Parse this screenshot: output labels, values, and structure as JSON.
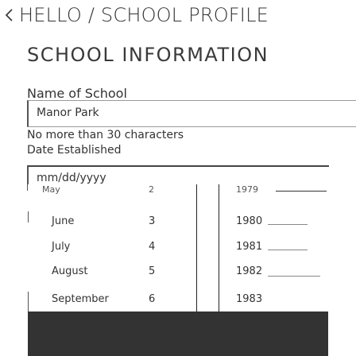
{
  "header": {
    "title": "HELLO / SCHOOL PROFILE",
    "back_icon": "chevron-left-icon"
  },
  "section": {
    "title": "SCHOOL INFORMATION"
  },
  "school_name": {
    "label": "Name of School",
    "value": "Manor Park",
    "hint": "No more than 30 characters"
  },
  "date_established": {
    "label": "Date Established",
    "placeholder": "mm/dd/yyyy"
  },
  "picker": {
    "months": [
      "May",
      "June",
      "July",
      "August",
      "September"
    ],
    "days": [
      "2",
      "3",
      "4",
      "5",
      "6"
    ],
    "years": [
      "1979",
      "1980",
      "1981",
      "1982",
      "1983"
    ]
  }
}
